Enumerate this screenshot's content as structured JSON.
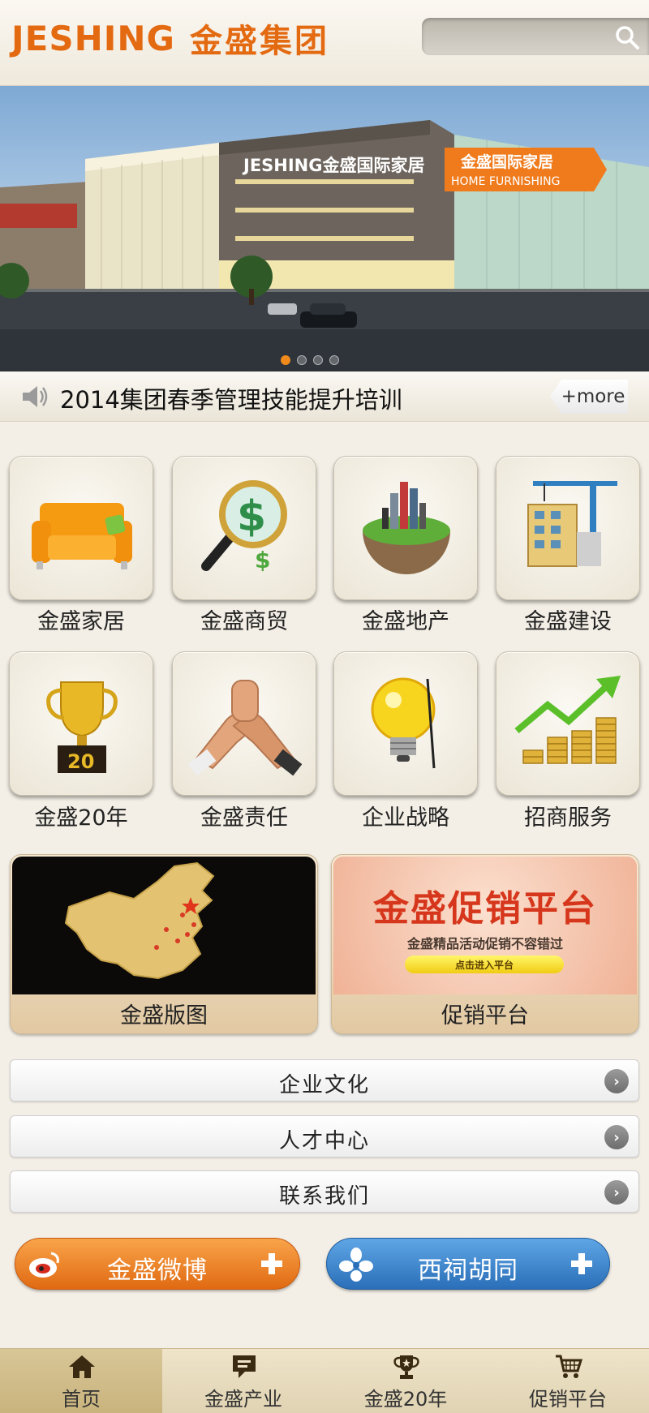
{
  "header": {
    "logo_en": "JESHING",
    "logo_cn": "金盛集团",
    "search_placeholder": ""
  },
  "banner": {
    "sign_text": "JESHING金盛国际家居",
    "badge_cn": "金盛国际家居",
    "badge_en": "HOME FURNISHING",
    "slide_count": 4,
    "active_slide": 1
  },
  "news": {
    "headline": "2014集团春季管理技能提升培训",
    "more_label": "+more"
  },
  "tiles": [
    {
      "label": "金盛家居",
      "icon": "sofa-icon"
    },
    {
      "label": "金盛商贸",
      "icon": "magnifier-dollar-icon"
    },
    {
      "label": "金盛地产",
      "icon": "city-globe-icon"
    },
    {
      "label": "金盛建设",
      "icon": "crane-building-icon"
    },
    {
      "label": "金盛20年",
      "icon": "trophy-icon"
    },
    {
      "label": "金盛责任",
      "icon": "handshake-icon"
    },
    {
      "label": "企业战略",
      "icon": "lightbulb-icon"
    },
    {
      "label": "招商服务",
      "icon": "coins-growth-icon"
    }
  ],
  "features": {
    "map_label": "金盛版图",
    "promo_label": "促销平台",
    "promo_title": "金盛促销平台",
    "promo_sub": "金盛精品活动促销不容错过",
    "promo_button": "点击进入平台"
  },
  "list_rows": [
    {
      "label": "企业文化"
    },
    {
      "label": "人才中心"
    },
    {
      "label": "联系我们"
    }
  ],
  "pills": {
    "weibo_label": "金盛微博",
    "hutong_label": "西祠胡同"
  },
  "bottom_nav": [
    {
      "label": "首页",
      "icon": "home-icon",
      "active": true
    },
    {
      "label": "金盛产业",
      "icon": "message-icon",
      "active": false
    },
    {
      "label": "金盛20年",
      "icon": "trophy-icon",
      "active": false
    },
    {
      "label": "促销平台",
      "icon": "cart-icon",
      "active": false
    }
  ],
  "colors": {
    "brand_orange": "#e46a12",
    "background": "#f3efe6",
    "nav_active": "#c9b37d",
    "weibo_orange": "#e06a12",
    "hutong_blue": "#2a6fb8"
  }
}
